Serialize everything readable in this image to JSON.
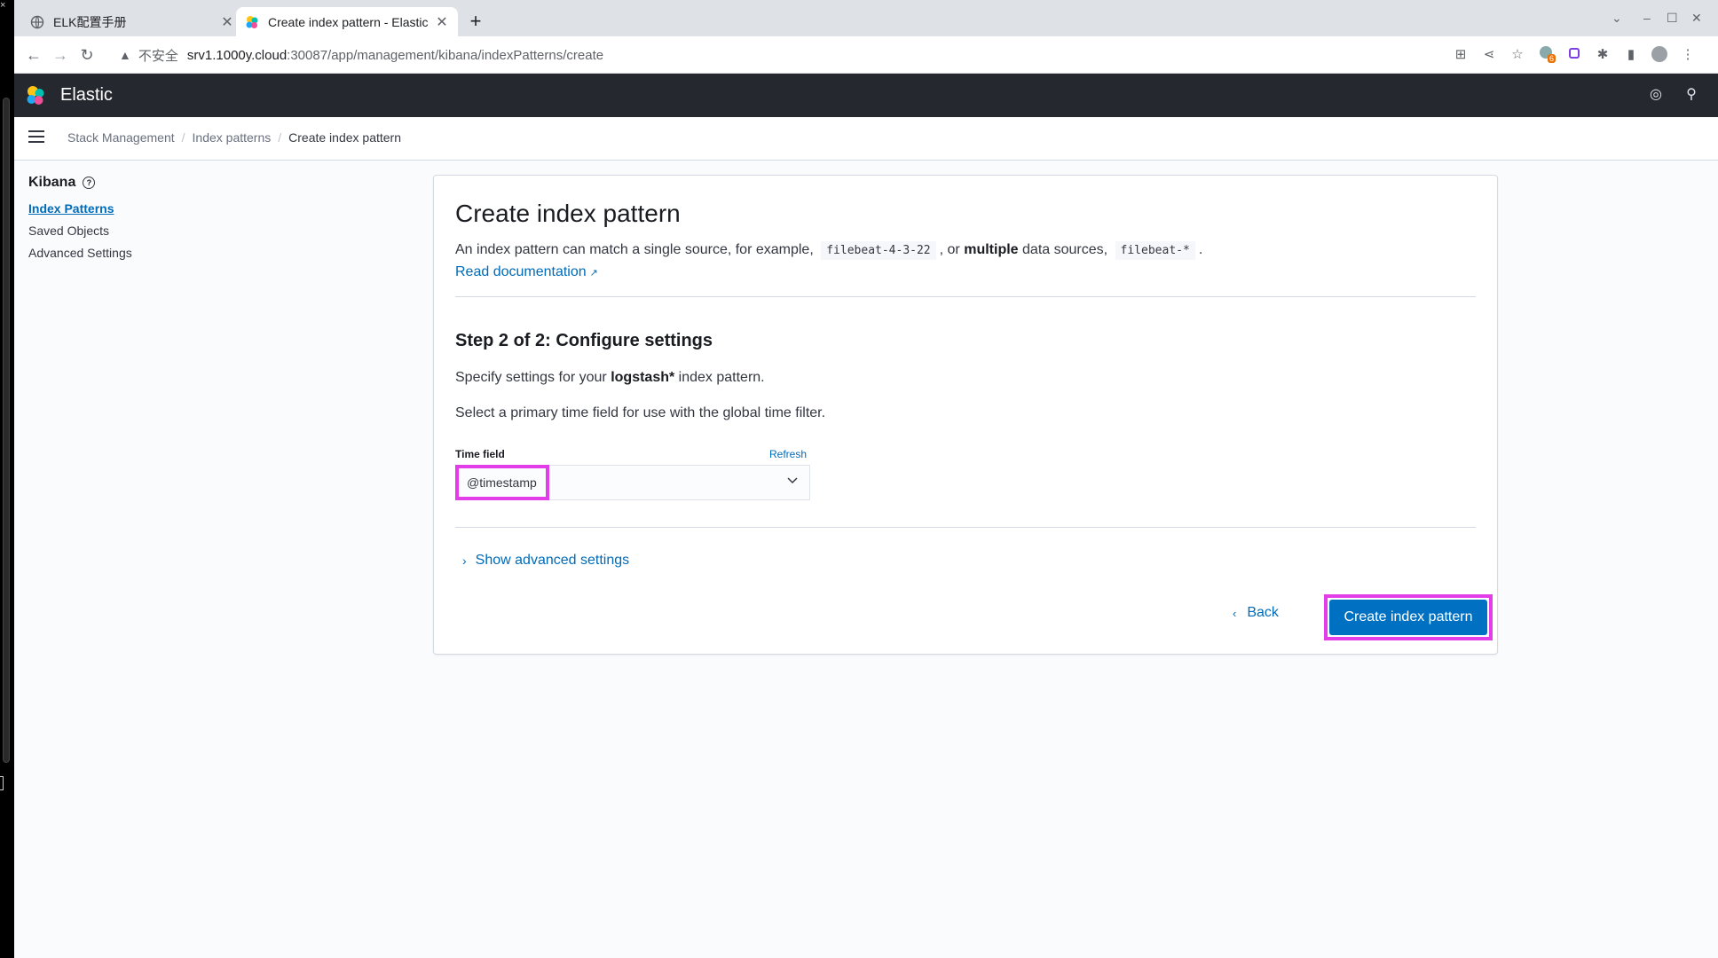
{
  "browser": {
    "tabs": [
      {
        "title": "ELK配置手册",
        "close": "✕"
      },
      {
        "title": "Create index pattern - Elastic",
        "close": "✕"
      }
    ],
    "new_tab": "+",
    "url_security": "不安全",
    "url_host": "srv1.1000y.cloud",
    "url_path": ":30087/app/management/kibana/indexPatterns/create",
    "extension_badge": "6"
  },
  "header": {
    "brand": "Elastic"
  },
  "breadcrumbs": [
    "Stack Management",
    "Index patterns",
    "Create index pattern"
  ],
  "sidebar": {
    "title": "Kibana",
    "help": "?",
    "items": [
      {
        "label": "Index Patterns",
        "active": true
      },
      {
        "label": "Saved Objects"
      },
      {
        "label": "Advanced Settings"
      }
    ]
  },
  "main": {
    "title": "Create index pattern",
    "desc_1": "An index pattern can match a single source, for example,",
    "example_1": "filebeat-4-3-22",
    "desc_2": ", or",
    "desc_bold": "multiple",
    "desc_3": "data sources,",
    "example_2": "filebeat-*",
    "desc_4": ".",
    "doc_link": "Read documentation",
    "step_title": "Step 2 of 2: Configure settings",
    "specify_pre": "Specify settings for your",
    "specify_pattern": "logstash*",
    "specify_post": "index pattern.",
    "select_text": "Select a primary time field for use with the global time filter.",
    "time_field_label": "Time field",
    "refresh_label": "Refresh",
    "time_field_value": "@timestamp",
    "advanced_label": "Show advanced settings",
    "back_label": "Back",
    "create_label": "Create index pattern"
  },
  "colors": {
    "highlight": "#e33dea",
    "primary": "#0071c2",
    "link": "#006bb8",
    "header_bg": "#25282f"
  }
}
